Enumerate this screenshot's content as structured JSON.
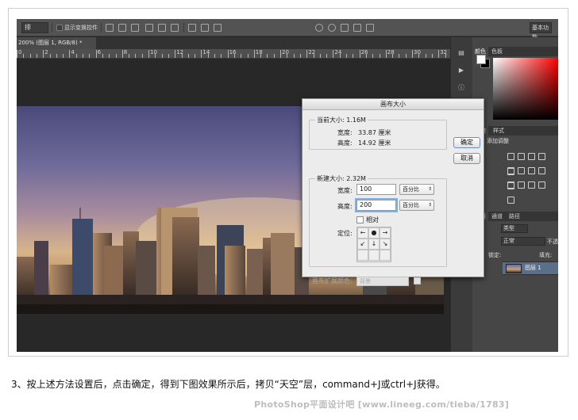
{
  "options_bar": {
    "arrange_select": "排",
    "show_transform_controls_label": "显示变换控件",
    "workspace_select": "基本功能"
  },
  "document_tab": {
    "title": "200% (图层 1, RGB/8) *"
  },
  "ruler": {
    "labels": [
      "0",
      "2",
      "4",
      "6",
      "8",
      "10",
      "12",
      "14",
      "16",
      "18",
      "20",
      "22",
      "24",
      "26",
      "28",
      "30",
      "32"
    ]
  },
  "panels": {
    "color_tabs": [
      "颜色",
      "色板"
    ],
    "adjust_tabs": [
      "调整",
      "样式"
    ],
    "adjust_label": "添加调整",
    "layers_tabs": [
      "图层",
      "通道",
      "路径"
    ],
    "kind_label": "类型",
    "blend_mode": "正常",
    "opacity_label": "不透明度:",
    "lock_label": "锁定:",
    "fill_label": "填充:",
    "layer_name": "图层 1"
  },
  "dialog": {
    "title": "画布大小",
    "current_size_label": "当前大小: 1.16M",
    "current_width_label": "宽度:",
    "current_width_value": "33.87 厘米",
    "current_height_label": "高度:",
    "current_height_value": "14.92 厘米",
    "new_size_label": "新建大小: 2.32M",
    "width_label": "宽度:",
    "width_value": "100",
    "width_unit": "百分比",
    "height_label": "高度:",
    "height_value": "200",
    "height_unit": "百分比",
    "relative_label": "相对",
    "anchor_label": "定位:",
    "extension_color_label": "画布扩展颜色:",
    "extension_color_value": "背景",
    "ok_button": "确定",
    "cancel_button": "取消"
  },
  "caption": {
    "text": "3、按上述方法设置后，点击确定，得到下图效果所示后，拷贝“天空”层，command+J或ctrl+J获得。"
  },
  "watermark": {
    "text": "PhotoShop平面设计吧 [www.lineeg.com/tieba/1783]"
  }
}
